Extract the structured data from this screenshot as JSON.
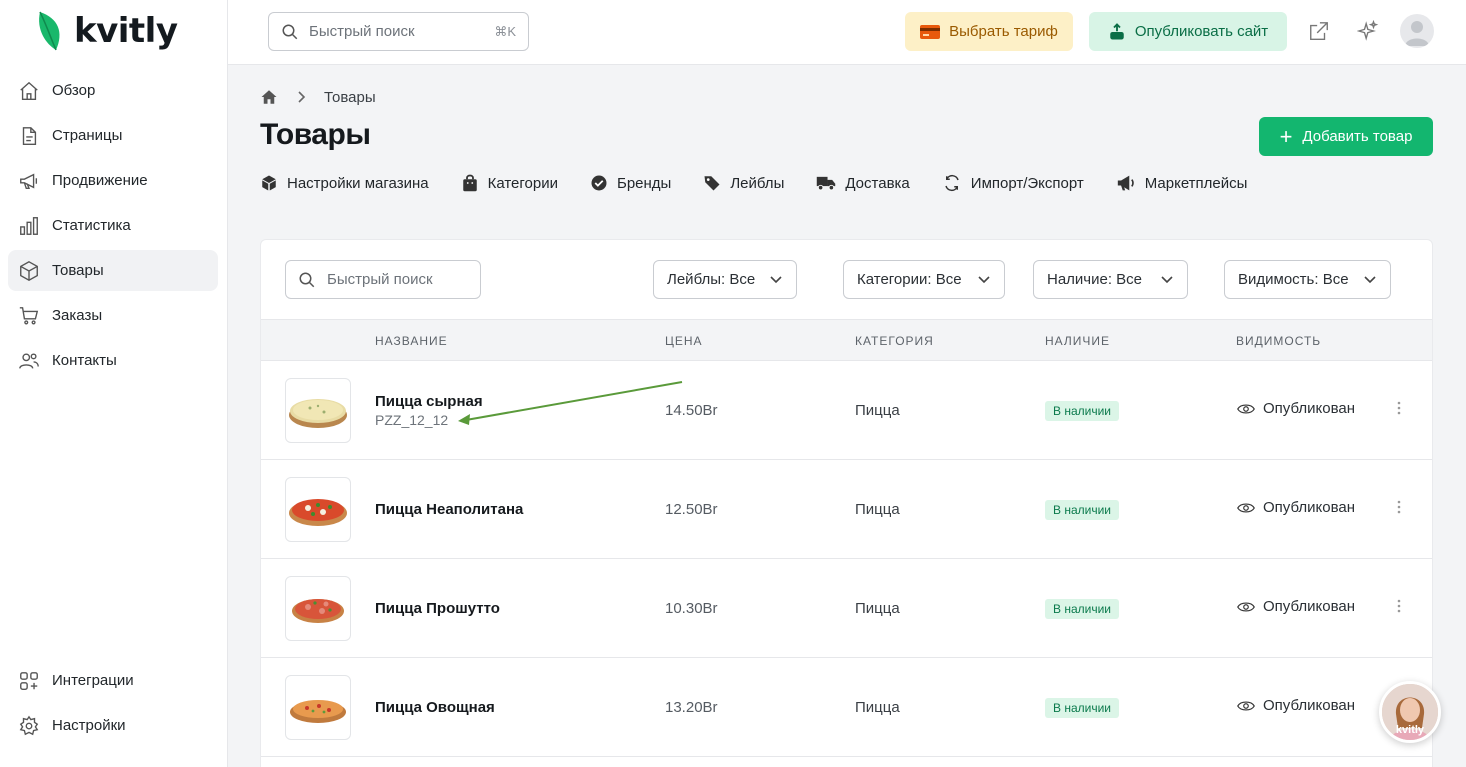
{
  "brand": {
    "name": "kvitly",
    "accent": "#13b66f"
  },
  "sidebar": {
    "items": [
      {
        "label": "Обзор",
        "icon": "home-icon"
      },
      {
        "label": "Страницы",
        "icon": "page-icon"
      },
      {
        "label": "Продвижение",
        "icon": "megaphone-icon"
      },
      {
        "label": "Статистика",
        "icon": "chart-icon"
      },
      {
        "label": "Товары",
        "icon": "box-icon",
        "active": true
      },
      {
        "label": "Заказы",
        "icon": "cart-icon"
      },
      {
        "label": "Контакты",
        "icon": "users-icon"
      }
    ],
    "bottom": [
      {
        "label": "Интеграции",
        "icon": "integrations-icon"
      },
      {
        "label": "Настройки",
        "icon": "gear-icon"
      }
    ]
  },
  "topbar": {
    "search_placeholder": "Быстрый поиск",
    "search_shortcut": "⌘K",
    "tariff_label": "Выбрать тариф",
    "publish_label": "Опубликовать сайт"
  },
  "breadcrumb": {
    "current": "Товары"
  },
  "page": {
    "title": "Товары",
    "add_label": "Добавить товар"
  },
  "subnav": [
    {
      "label": "Настройки магазина",
      "icon": "cube-icon"
    },
    {
      "label": "Категории",
      "icon": "bag-icon"
    },
    {
      "label": "Бренды",
      "icon": "badge-check-icon"
    },
    {
      "label": "Лейблы",
      "icon": "tag-icon"
    },
    {
      "label": "Доставка",
      "icon": "truck-icon"
    },
    {
      "label": "Импорт/Экспорт",
      "icon": "sync-icon"
    },
    {
      "label": "Маркетплейсы",
      "icon": "loudspeaker-icon"
    }
  ],
  "filters": {
    "search_placeholder": "Быстрый поиск",
    "labels": "Лейблы: Все",
    "categories": "Категории: Все",
    "stock": "Наличие: Все",
    "visibility": "Видимость: Все"
  },
  "table": {
    "headers": {
      "name": "НАЗВАНИЕ",
      "price": "ЦЕНА",
      "category": "КАТЕГОРИЯ",
      "stock": "НАЛИЧИЕ",
      "visibility": "ВИДИМОСТЬ"
    },
    "rows": [
      {
        "name": "Пицца сырная",
        "sku": "PZZ_12_12",
        "price": "14.50Br",
        "category": "Пицца",
        "stock": "В наличии",
        "visibility": "Опубликован"
      },
      {
        "name": "Пицца Неаполитана",
        "sku": "",
        "price": "12.50Br",
        "category": "Пицца",
        "stock": "В наличии",
        "visibility": "Опубликован"
      },
      {
        "name": "Пицца Прошутто",
        "sku": "",
        "price": "10.30Br",
        "category": "Пицца",
        "stock": "В наличии",
        "visibility": "Опубликован"
      },
      {
        "name": "Пицца Овощная",
        "sku": "",
        "price": "13.20Br",
        "category": "Пицца",
        "stock": "В наличии",
        "visibility": "Опубликован"
      }
    ]
  },
  "chat": {
    "tag": "kvitly"
  }
}
